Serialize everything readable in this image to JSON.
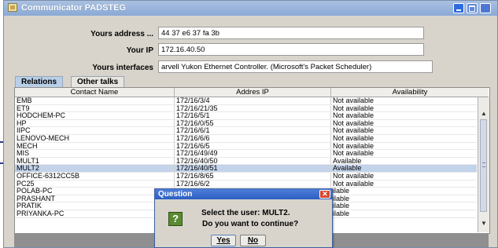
{
  "window": {
    "title": "Communicator PADSTEG"
  },
  "fields": [
    {
      "label": "Yours address ...",
      "value": "44 37 e6 37 fa 3b"
    },
    {
      "label": "Your IP",
      "value": "172.16.40.50"
    },
    {
      "label": "Yours interfaces",
      "value": "arvell Yukon Ethernet Controller. (Microsoft's Packet Scheduler)"
    }
  ],
  "tabs": [
    {
      "label": "Relations",
      "active": true
    },
    {
      "label": "Other talks",
      "active": false
    }
  ],
  "table": {
    "columns": [
      "Contact Name",
      "Addres IP",
      "Availability"
    ],
    "rows": [
      {
        "name": "EMB",
        "ip": "172/16/3/4",
        "availability": "Not available"
      },
      {
        "name": "ET9",
        "ip": "172/16/21/35",
        "availability": "Not available"
      },
      {
        "name": "HODCHEM-PC",
        "ip": "172/16/5/1",
        "availability": "Not available"
      },
      {
        "name": "HP",
        "ip": "172/16/0/55",
        "availability": "Not available"
      },
      {
        "name": "IIPC",
        "ip": "172/16/6/1",
        "availability": "Not available"
      },
      {
        "name": "LENOVO-MECH",
        "ip": "172/16/6/6",
        "availability": "Not available"
      },
      {
        "name": "MECH",
        "ip": "172/16/6/5",
        "availability": "Not available"
      },
      {
        "name": "MIS",
        "ip": "172/16/49/49",
        "availability": "Not available"
      },
      {
        "name": "MULT1",
        "ip": "172/16/40/50",
        "availability": "Available"
      },
      {
        "name": "MULT2",
        "ip": "172/16/40/51",
        "availability": "Available",
        "selected": true
      },
      {
        "name": "OFFICE-6312CC5B",
        "ip": "172/16/8/65",
        "availability": "Not available"
      },
      {
        "name": "PC25",
        "ip": "172/16/6/2",
        "availability": "Not available"
      },
      {
        "name": "POLAB-PC",
        "ip": "",
        "availability": "ilable"
      },
      {
        "name": "PRASHANT",
        "ip": "",
        "availability": "ilable"
      },
      {
        "name": "PRATIK",
        "ip": "",
        "availability": "ilable"
      },
      {
        "name": "PRIYANKA-PC",
        "ip": "",
        "availability": "ilable"
      }
    ]
  },
  "dialog": {
    "title": "Question",
    "line1": "Select the user: MULT2.",
    "line2": "Do you want to continue?",
    "yes_label": "Yes",
    "no_label": "No",
    "icon": "question-icon"
  },
  "colors": {
    "titlebar": "#8aa9d6",
    "selected_row": "#c3d3ea",
    "dialog_title": "#2c5fc4",
    "close_button": "#d8472b"
  }
}
